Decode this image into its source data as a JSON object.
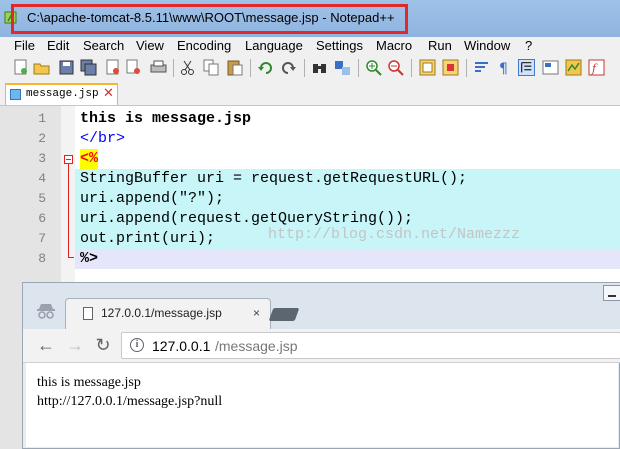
{
  "notepad": {
    "title": "C:\\apache-tomcat-8.5.11\\www\\ROOT\\message.jsp - Notepad++",
    "menu": [
      "File",
      "Edit",
      "Search",
      "View",
      "Encoding",
      "Language",
      "Settings",
      "Macro",
      "Run",
      "Window",
      "?"
    ],
    "tab": {
      "label": "message.jsp"
    },
    "lines": [
      {
        "num": "1",
        "code": "this is message.jsp"
      },
      {
        "num": "2",
        "code": "</br>"
      },
      {
        "num": "3",
        "code": "<%"
      },
      {
        "num": "4",
        "code": "StringBuffer uri = request.getRequestURL();"
      },
      {
        "num": "5",
        "code": "uri.append(\"?\");"
      },
      {
        "num": "6",
        "code": "uri.append(request.getQueryString());"
      },
      {
        "num": "7",
        "code": "out.print(uri);"
      },
      {
        "num": "8",
        "code": "%>"
      }
    ],
    "watermark": "http://blog.csdn.net/Namezzz"
  },
  "browser": {
    "tab_label": "127.0.0.1/message.jsp",
    "tab_close": "×",
    "url_host": "127.0.0.1",
    "url_path": "/message.jsp",
    "content": [
      "this is message.jsp",
      "http://127.0.0.1/message.jsp?null"
    ]
  },
  "colors": {
    "title_highlight": "#e2282b",
    "php_block_bg": "#c7f5f8",
    "delim_bg": "#ffff00",
    "html_tag": "#0000ff",
    "selected_line_bg": "#e6e6fa"
  },
  "icons": [
    "notepadpp-icon",
    "incognito-icon",
    "page-icon",
    "back-arrow-icon",
    "forward-arrow-icon",
    "reload-icon",
    "info-icon"
  ]
}
